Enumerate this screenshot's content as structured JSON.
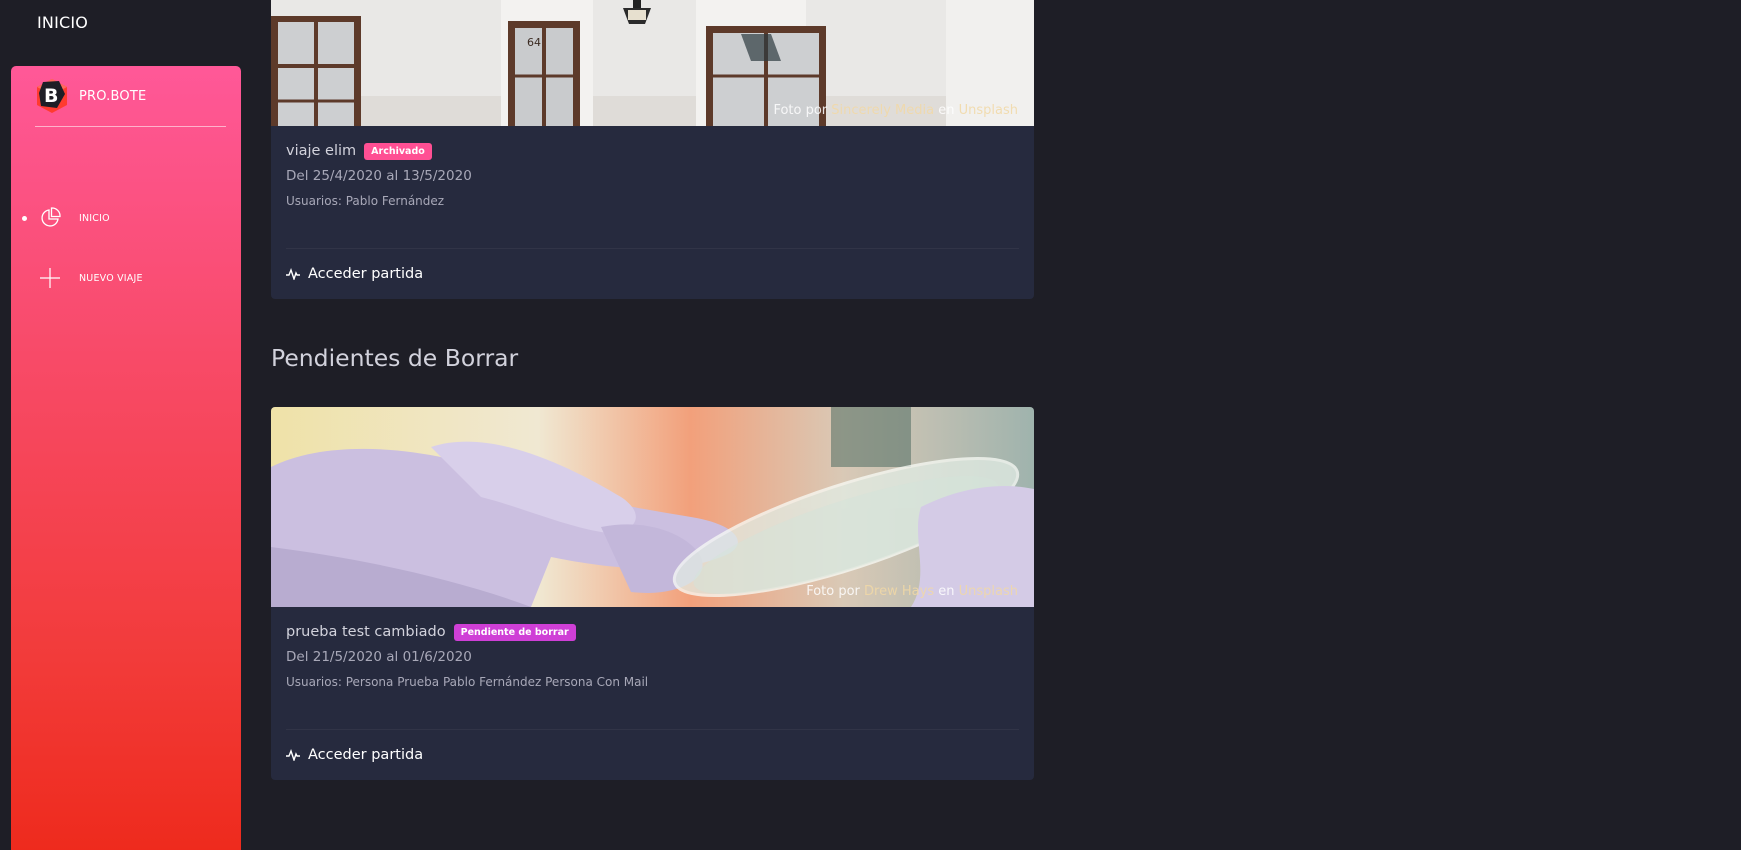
{
  "header": {
    "title": "INICIO"
  },
  "sidebar": {
    "brand": "PRO.BOTE",
    "items": [
      {
        "label": "INICIO",
        "icon": "pie-chart-icon",
        "active": true
      },
      {
        "label": "NUEVO VIAJE",
        "icon": "plus-icon",
        "active": false
      }
    ],
    "gradient": [
      "#ff5898",
      "#ee2a1c"
    ]
  },
  "sections": {
    "pending_title": "Pendientes de Borrar"
  },
  "cards": [
    {
      "credit": {
        "prefix": "Foto por",
        "author": "Sincerely Media",
        "middle": "en",
        "source": "Unsplash"
      },
      "title": "viaje elim",
      "badge": "Archivado",
      "badge_color": "#ff4f93",
      "dates": "Del 25/4/2020 al 13/5/2020",
      "users": "Usuarios: Pablo Fernández",
      "action": "Acceder partida"
    },
    {
      "credit": {
        "prefix": "Foto por",
        "author": "Drew Hays",
        "middle": "en",
        "source": "Unsplash"
      },
      "title": "prueba test cambiado",
      "badge": "Pendiente de borrar",
      "badge_color": "#cf3fd6",
      "dates": "Del 21/5/2020 al 01/6/2020",
      "users": "Usuarios: Persona Prueba Pablo Fernández Persona Con Mail",
      "action": "Acceder partida"
    }
  ]
}
